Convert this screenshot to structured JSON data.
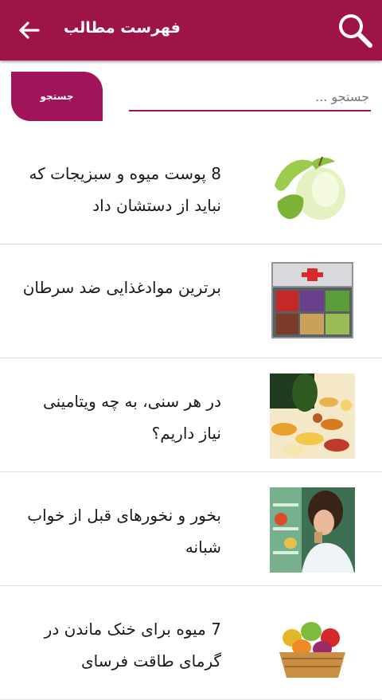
{
  "header": {
    "title": "فهرست مطالب",
    "back_icon": "arrow-left-icon",
    "search_icon": "magnifier-icon",
    "background": "#9e1448"
  },
  "search": {
    "placeholder": "جستجو ...",
    "value": "",
    "button_label": "جستجو",
    "accent": "#a0155a"
  },
  "articles": [
    {
      "title": "8 پوست میوه و سبزیجات که نباید از دستشان داد",
      "thumb": "peeled-apple-image"
    },
    {
      "title": "برترین موادغذایی ضد سرطان",
      "thumb": "food-box-image"
    },
    {
      "title": "در هر سنی، به چه ویتامینی نیاز داریم؟",
      "thumb": "vitamin-pills-image"
    },
    {
      "title": "بخور و نخورهای قبل از خواب شبانه",
      "thumb": "woman-at-fridge-image"
    },
    {
      "title": "7 میوه برای خنک ماندن در گرمای طاقت فرسای",
      "thumb": "fruit-basket-image"
    }
  ]
}
